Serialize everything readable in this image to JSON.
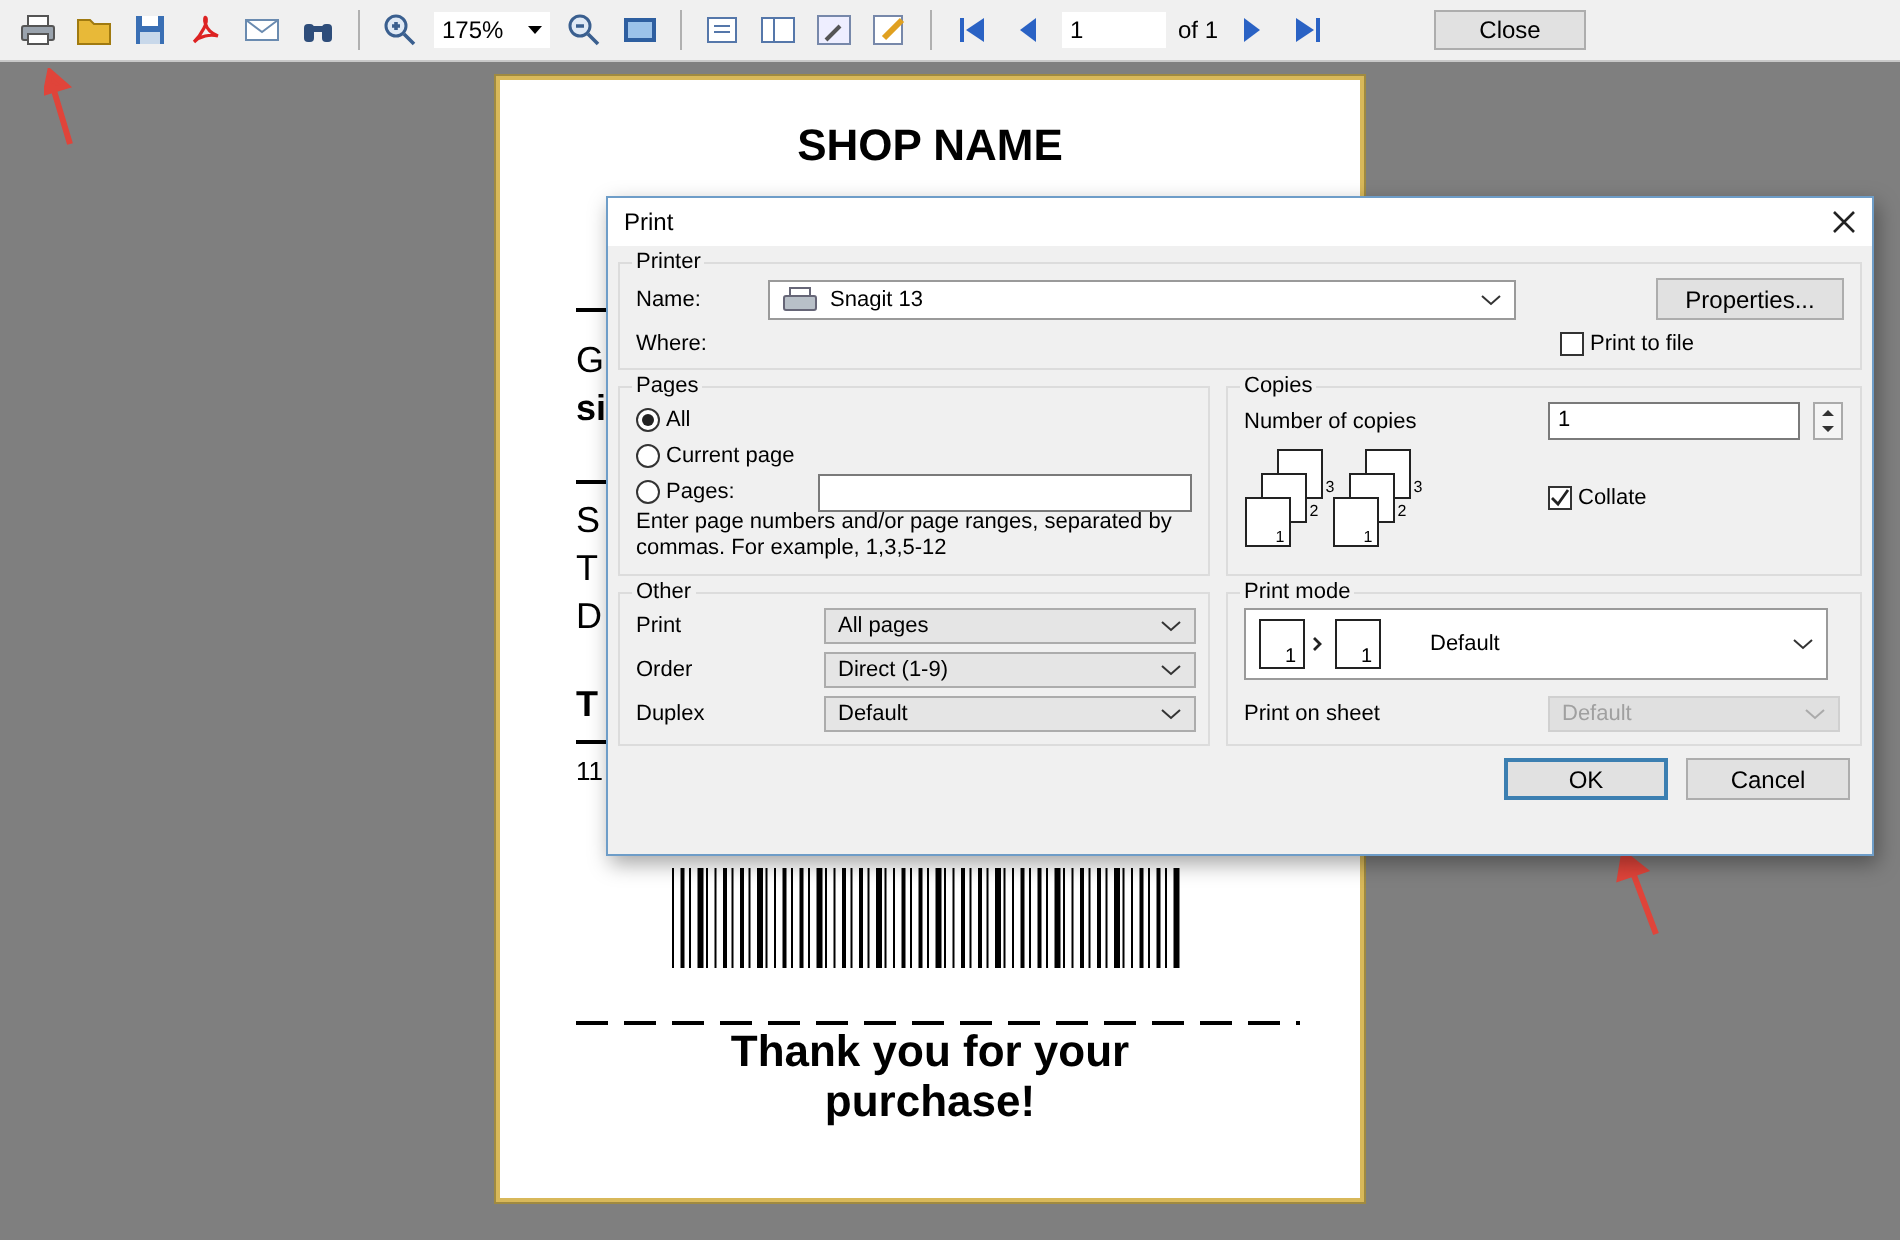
{
  "toolbar": {
    "zoom": "175%",
    "page": "1",
    "page_count": "of 1",
    "close": "Close"
  },
  "receipt": {
    "shop_name": "SHOP NAME",
    "lines": [
      {
        "kind": "rule"
      },
      {
        "kind": "text",
        "text": "G",
        "bold": false
      },
      {
        "kind": "text",
        "text": "si",
        "bold": true
      },
      {
        "kind": "rule"
      },
      {
        "kind": "text",
        "text": "S",
        "bold": false
      },
      {
        "kind": "text",
        "text": "T",
        "bold": false
      },
      {
        "kind": "text",
        "text": "D",
        "bold": false
      },
      {
        "kind": "text",
        "text": "T",
        "bold": true
      },
      {
        "kind": "rule"
      },
      {
        "kind": "text",
        "text": "11",
        "bold": false
      }
    ],
    "thanks": "Thank you for your purchase!"
  },
  "dialog": {
    "title": "Print",
    "printer": {
      "label": "Printer",
      "name_label": "Name:",
      "name": "Snagit 13",
      "where_label": "Where:",
      "properties": "Properties...",
      "print_to_file": {
        "label": "Print to file",
        "checked": false
      }
    },
    "pages": {
      "label": "Pages",
      "options": [
        {
          "label": "All",
          "selected": true
        },
        {
          "label": "Current page",
          "selected": false
        },
        {
          "label": "Pages:",
          "selected": false
        }
      ],
      "hint": "Enter page numbers and/or page ranges, separated by commas. For example, 1,3,5-12"
    },
    "copies": {
      "label": "Copies",
      "number_label": "Number of copies",
      "value": "1",
      "stack_labels": [
        "3",
        "2",
        "1",
        "3",
        "2",
        "1"
      ],
      "collate": {
        "label": "Collate",
        "checked": true
      }
    },
    "other": {
      "label": "Other",
      "rows": [
        {
          "label": "Print",
          "value": "All pages"
        },
        {
          "label": "Order",
          "value": "Direct (1-9)"
        },
        {
          "label": "Duplex",
          "value": "Default"
        }
      ]
    },
    "print_mode": {
      "label": "Print mode",
      "icon_labels": [
        "1",
        "1"
      ],
      "value": "Default",
      "sheet_label": "Print on sheet",
      "sheet_value": "Default",
      "sheet_disabled": true
    },
    "buttons": [
      {
        "label": "OK",
        "default": true
      },
      {
        "label": "Cancel",
        "default": false
      }
    ]
  }
}
